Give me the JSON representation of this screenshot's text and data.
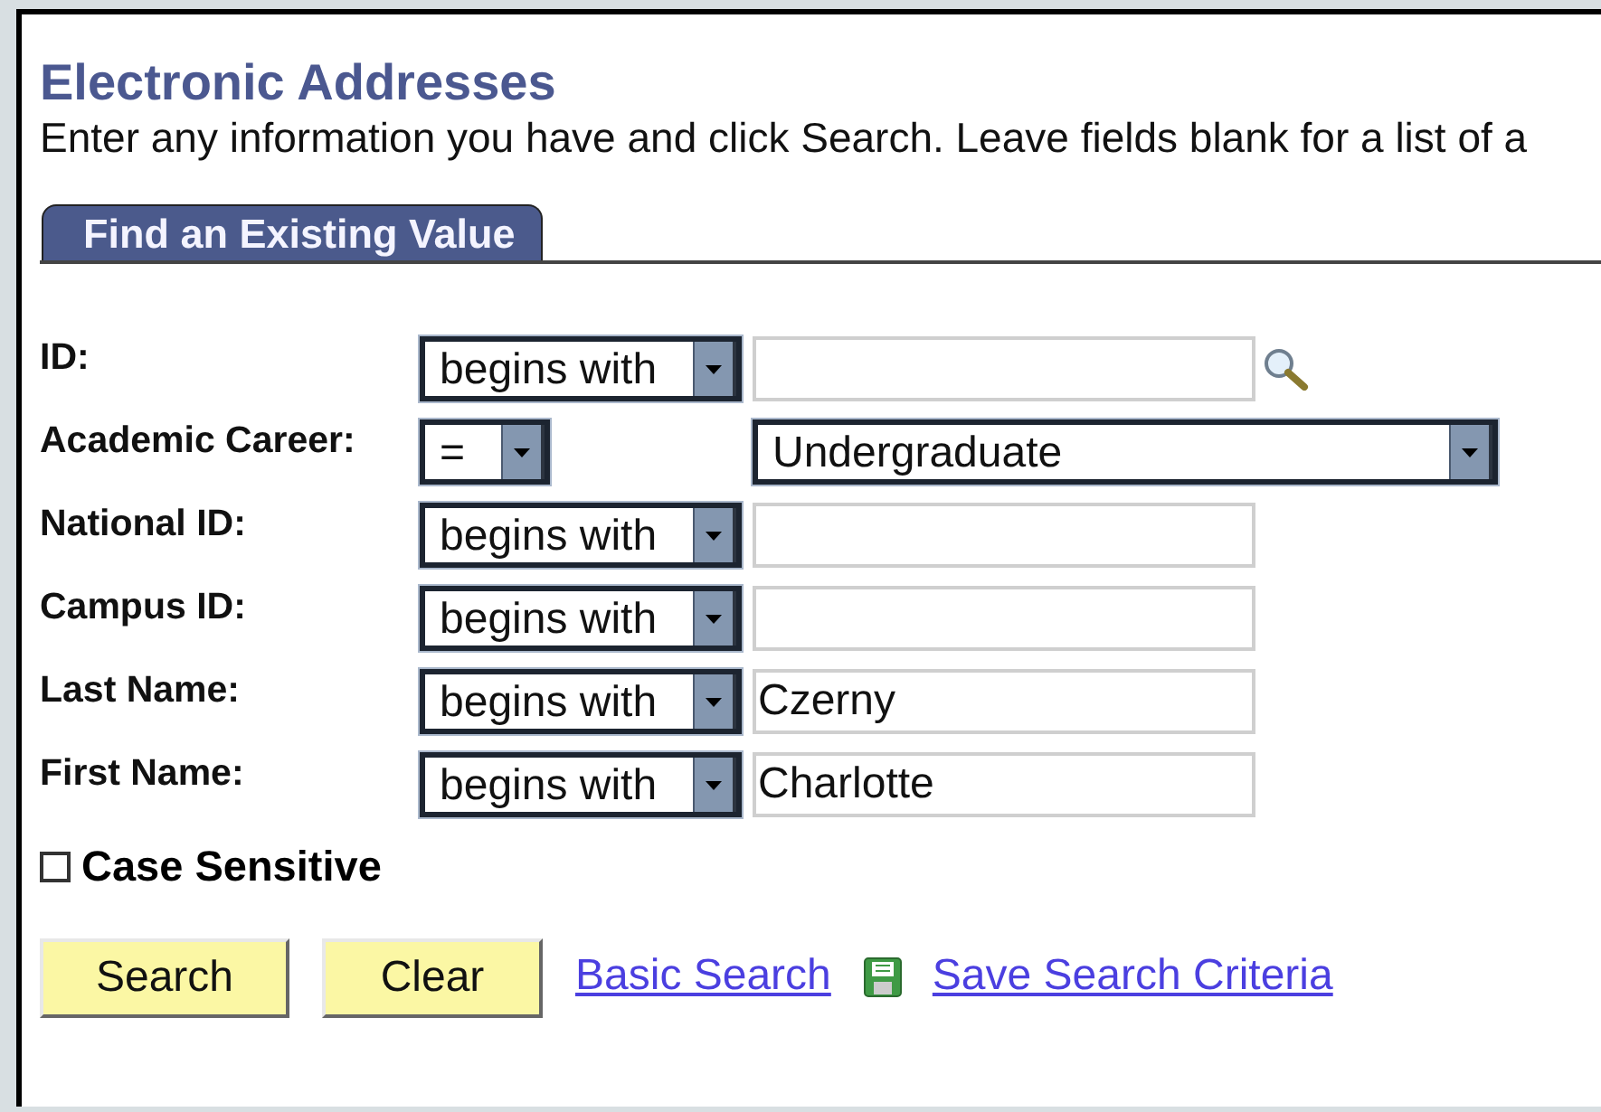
{
  "page": {
    "title": "Electronic Addresses",
    "instructions": "Enter any information you have and click Search. Leave fields blank for a list of a"
  },
  "tabs": [
    {
      "label": "Find an Existing Value",
      "selected": true
    }
  ],
  "fields": [
    {
      "label": "ID:",
      "operator": "begins with",
      "kind": "text",
      "lookup": true
    },
    {
      "label": "Academic Career:",
      "operator": "=",
      "kind": "dropdown",
      "value": "Undergraduate"
    },
    {
      "label": "National ID:",
      "operator": "begins with",
      "kind": "text"
    },
    {
      "label": "Campus ID:",
      "operator": "begins with",
      "kind": "text"
    },
    {
      "label": "Last Name:",
      "operator": "begins with",
      "kind": "text",
      "value": "Czerny"
    },
    {
      "label": "First Name:",
      "operator": "begins with",
      "kind": "text",
      "value": "Charlotte"
    }
  ],
  "case_sensitive": {
    "label": "Case Sensitive",
    "checked": false
  },
  "buttons": [
    "Search",
    "Clear"
  ],
  "links": [
    {
      "label": "Basic Search",
      "icon": false
    },
    {
      "label": "Save Search Criteria",
      "icon": true
    }
  ]
}
